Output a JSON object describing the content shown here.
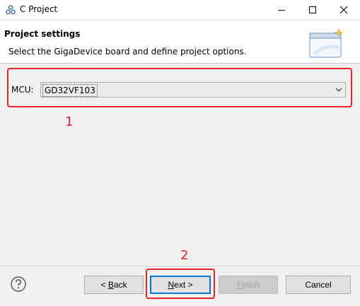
{
  "window": {
    "title": "C Project",
    "icons": [
      "c-project-icon",
      "minimize-icon",
      "maximize-icon",
      "close-icon"
    ]
  },
  "header": {
    "title": "Project settings",
    "description": "Select the GigaDevice board and define project options."
  },
  "mcu": {
    "label": "MCU:",
    "selected": "GD32VF103"
  },
  "annotations": {
    "step1": "1",
    "step2": "2"
  },
  "buttons": {
    "back": {
      "prefix": "< ",
      "mnemonic": "B",
      "rest": "ack"
    },
    "next": {
      "mnemonic": "N",
      "rest": "ext >"
    },
    "finish": {
      "mnemonic": "F",
      "rest": "inish",
      "enabled": false
    },
    "cancel": "Cancel"
  },
  "colors": {
    "annotation_red": "#e8242a",
    "focus_blue": "#0078d7",
    "dialog_background": "#f0f0f0"
  }
}
